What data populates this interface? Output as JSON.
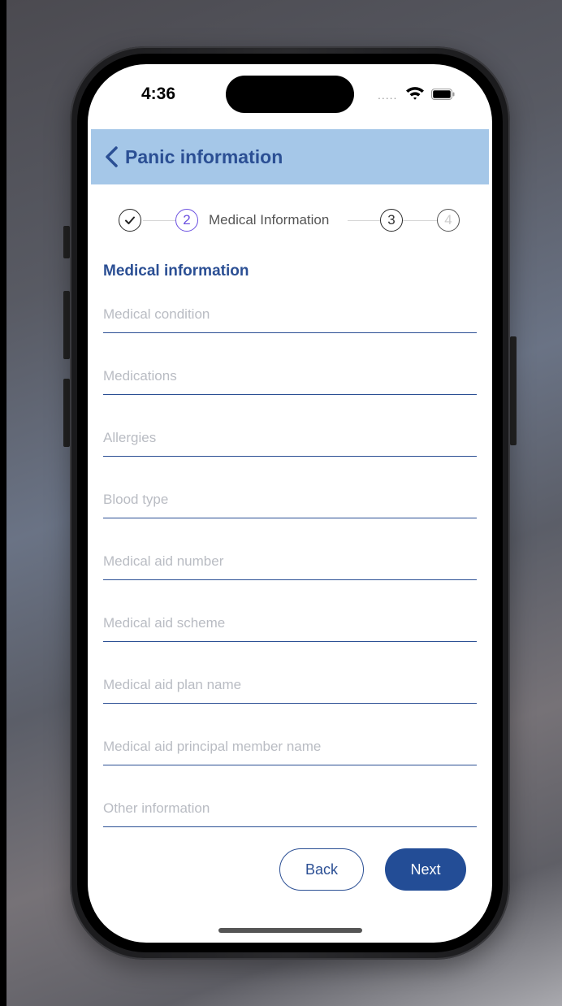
{
  "status_bar": {
    "time": "4:36",
    "signal": "....."
  },
  "header": {
    "title": "Panic information"
  },
  "stepper": {
    "steps": [
      {
        "label": "",
        "state": "completed"
      },
      {
        "label": "2",
        "state": "active"
      },
      {
        "label": "3",
        "state": "upcoming"
      },
      {
        "label": "4",
        "state": "disabled"
      }
    ],
    "active_label": "Medical Information"
  },
  "form": {
    "section_title": "Medical information",
    "fields": [
      {
        "placeholder": "Medical condition",
        "value": ""
      },
      {
        "placeholder": "Medications",
        "value": ""
      },
      {
        "placeholder": "Allergies",
        "value": ""
      },
      {
        "placeholder": "Blood type",
        "value": ""
      },
      {
        "placeholder": "Medical aid number",
        "value": ""
      },
      {
        "placeholder": "Medical aid scheme",
        "value": ""
      },
      {
        "placeholder": "Medical aid plan name",
        "value": ""
      },
      {
        "placeholder": "Medical aid principal member name",
        "value": ""
      },
      {
        "placeholder": "Other information",
        "value": ""
      }
    ]
  },
  "actions": {
    "back_label": "Back",
    "next_label": "Next"
  },
  "colors": {
    "primary": "#2b4f94",
    "header_bg": "#a5c7e8",
    "active_step": "#6a4fe0",
    "disabled_step": "#cccccc"
  },
  "icons": {
    "back": "chevron-left-icon",
    "check": "checkmark-icon",
    "wifi": "wifi-icon",
    "battery": "battery-icon"
  }
}
